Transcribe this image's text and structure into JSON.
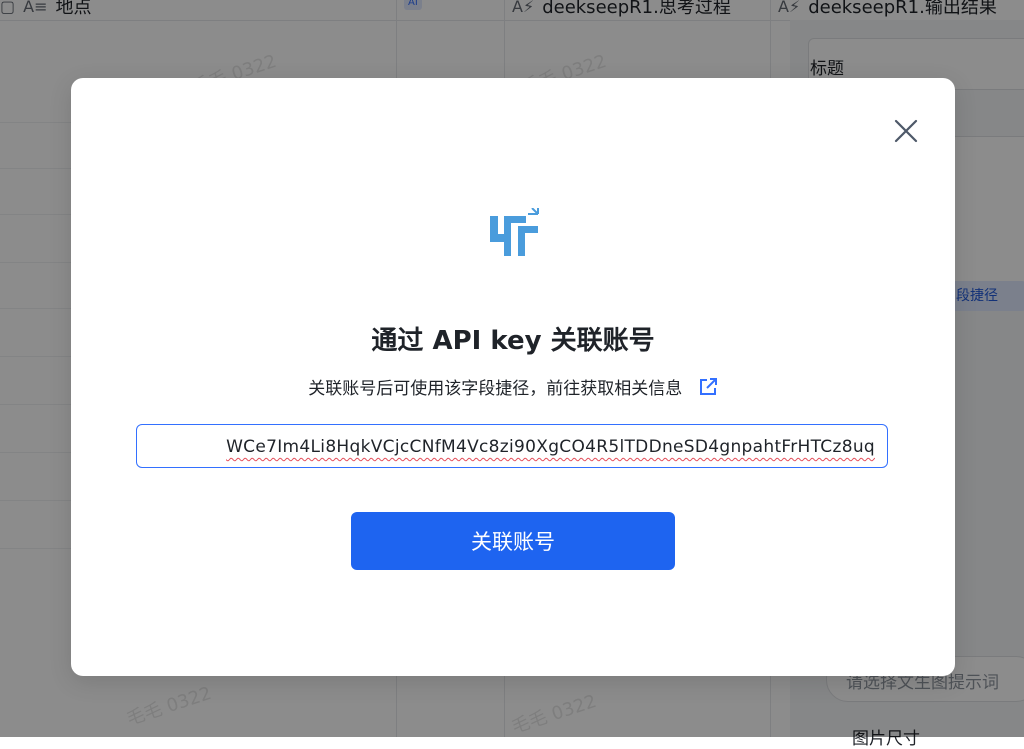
{
  "background": {
    "columns": [
      {
        "label": "地点",
        "type_icon": "text-type-icon"
      },
      {
        "label": "deekseepR1.思考过程",
        "type_icon": "ai-text-type-icon"
      },
      {
        "label": "deekseepR1.输出结果",
        "type_icon": "ai-text-type-icon"
      }
    ],
    "ai_badge": "AI",
    "panel": {
      "title_label": "标题",
      "shortcut_chip": "段捷径",
      "prompt_placeholder": "请选择文生图提示词",
      "image_size_label": "图片尺寸"
    },
    "watermark": "毛毛 0322"
  },
  "modal": {
    "title": "通过 API key 关联账号",
    "subtitle": "关联账号后可使用该字段捷径，前往获取相关信息",
    "api_key_value": "WCe7Im4Li8HqkVCjcCNfM4Vc8zi90XgCO4R5lTDDneSD4gnpahtFrHTCz8uq",
    "submit_label": "关联账号",
    "logo_icon": "feishu-shortcut-logo-icon",
    "close_icon": "close-icon",
    "external_link_icon": "external-link-icon"
  },
  "colors": {
    "primary": "#1e64f0",
    "accent_blue": "#3370ff",
    "logo_blue": "#4a9cdc"
  }
}
